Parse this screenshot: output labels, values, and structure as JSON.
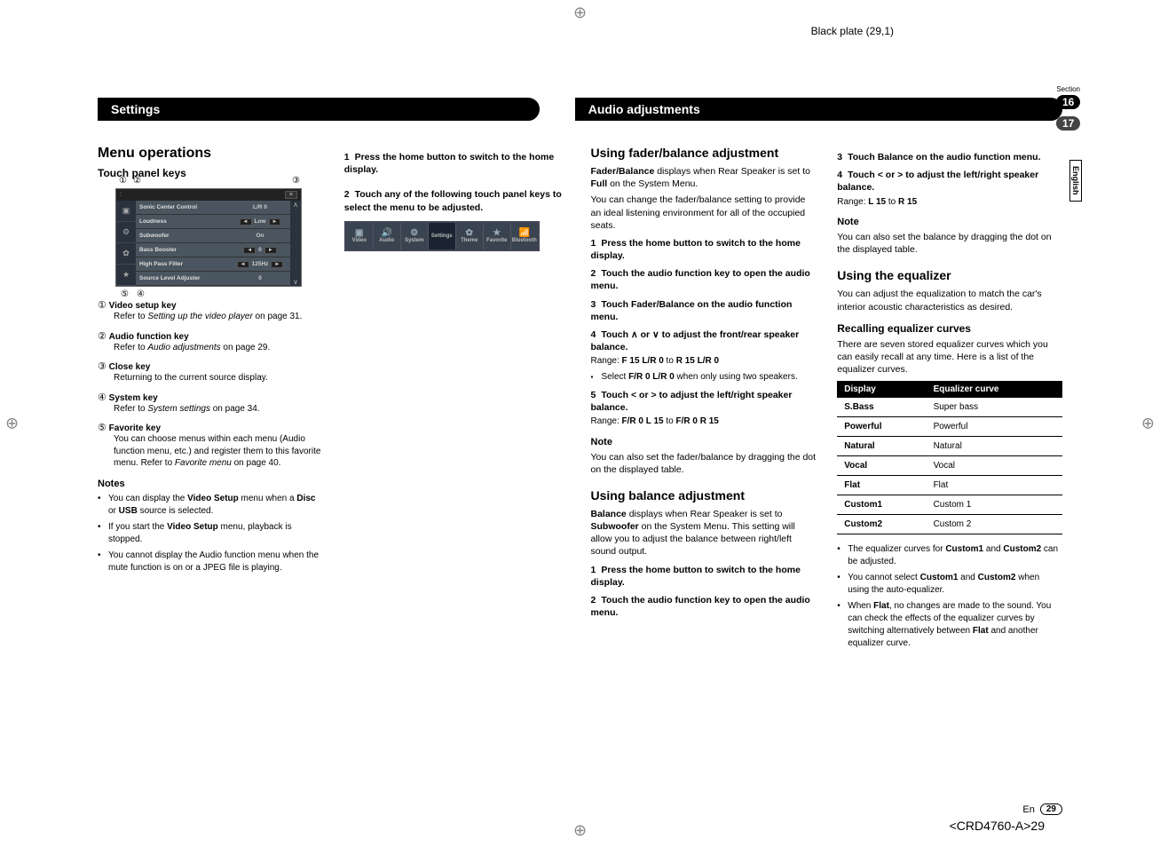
{
  "plate_label": "Black plate (29,1)",
  "header_left": "Settings",
  "header_right": "Audio adjustments",
  "section_label": "Section",
  "section_num_a": "16",
  "section_num_b": "17",
  "lang_tab": "English",
  "col1": {
    "h2": "Menu operations",
    "h3": "Touch panel keys",
    "ui": {
      "title_left": ":",
      "close": "×",
      "rows": [
        {
          "label": "Sonic Center Control",
          "value": "L/R  0",
          "arrows": false
        },
        {
          "label": "Loudness",
          "value": "Low",
          "arrows": true
        },
        {
          "label": "Subwoofer",
          "value": "On",
          "arrows": false
        },
        {
          "label": "Bass Booster",
          "value": "0",
          "arrows": true
        },
        {
          "label": "High Pass Filter",
          "value": "125Hz",
          "arrows": true
        },
        {
          "label": "Source Level Adjuster",
          "value": "0",
          "arrows": false
        }
      ],
      "side_icons": [
        "▣",
        "⚙",
        "✿",
        "★"
      ],
      "callouts": {
        "c1": "①",
        "c2": "②",
        "c3": "③",
        "c4": "④",
        "c5": "⑤"
      }
    },
    "keys": [
      {
        "num": "①",
        "title": "Video setup key",
        "desc_pre": "Refer to ",
        "desc_it": "Setting up the video player",
        "desc_post": " on page 31."
      },
      {
        "num": "②",
        "title": "Audio function key",
        "desc_pre": "Refer to ",
        "desc_it": "Audio adjustments",
        "desc_post": " on page 29."
      },
      {
        "num": "③",
        "title": "Close key",
        "desc_pre": "Returning to the current source display.",
        "desc_it": "",
        "desc_post": ""
      },
      {
        "num": "④",
        "title": "System key",
        "desc_pre": "Refer to ",
        "desc_it": "System settings",
        "desc_post": " on page 34."
      },
      {
        "num": "⑤",
        "title": "Favorite key",
        "desc_pre": "You can choose menus within each menu (Audio function menu, etc.) and register them to this favorite menu.\nRefer to ",
        "desc_it": "Favorite menu",
        "desc_post": " on page 40."
      }
    ],
    "notes_h": "Notes",
    "notes": [
      {
        "pre": "You can display the ",
        "b": "Video Setup",
        "post": " menu when a ",
        "b2": "Disc",
        "mid": " or ",
        "b3": "USB",
        "post2": " source is selected."
      },
      {
        "pre": "If you start the ",
        "b": "Video Setup",
        "post": " menu, playback is stopped."
      },
      {
        "pre": "You cannot display the Audio function menu when the mute function is on or a JPEG file is playing."
      }
    ]
  },
  "col2": {
    "step1_num": "1",
    "step1": "Press the home button to switch to the home display.",
    "step2_num": "2",
    "step2": "Touch any of the following touch panel keys to select the menu to be adjusted.",
    "strip": [
      {
        "icon": "▣",
        "label": "Video"
      },
      {
        "icon": "🔊",
        "label": "Audio"
      },
      {
        "icon": "⚙",
        "label": "System"
      },
      {
        "icon": "",
        "label": "Settings",
        "sel": true
      },
      {
        "icon": "✿",
        "label": "Theme"
      },
      {
        "icon": "★",
        "label": "Favorite"
      },
      {
        "icon": "📶",
        "label": "Bluetooth"
      }
    ]
  },
  "col3": {
    "h2a": "Using fader/balance adjustment",
    "intro_a": "Fader/Balance",
    "intro_b": " displays when Rear Speaker is set to ",
    "intro_c": "Full",
    "intro_d": " on the System Menu.",
    "intro_e": "You can change the fader/balance setting to provide an ideal listening environment for all of the occupied seats.",
    "steps_a": [
      {
        "n": "1",
        "t": "Press the home button to switch to the home display."
      },
      {
        "n": "2",
        "t": "Touch the audio function key to open the audio menu."
      },
      {
        "n": "3",
        "t": "Touch Fader/Balance on the audio function menu."
      },
      {
        "n": "4",
        "t": "Touch ∧ or ∨ to adjust the front/rear speaker balance."
      }
    ],
    "range_a_pre": "Range: ",
    "range_a_b1": "F 15 L/R 0",
    "range_a_mid": " to ",
    "range_a_b2": "R 15 L/R 0",
    "sub_a_pre": "Select ",
    "sub_a_b": "F/R 0  L/R 0",
    "sub_a_post": " when only using two speakers.",
    "step5_n": "5",
    "step5": "Touch < or > to adjust the left/right speaker balance.",
    "range_b_pre": "Range: ",
    "range_b_b1": "F/R 0 L 15",
    "range_b_mid": " to ",
    "range_b_b2": "F/R 0 R 15",
    "note_h": "Note",
    "note_a": "You can also set the fader/balance by dragging the dot on the displayed table.",
    "h2b": "Using balance adjustment",
    "bal_a": "Balance",
    "bal_b": " displays when Rear Speaker is set to ",
    "bal_c": "Subwoofer",
    "bal_d": " on the System Menu. This setting will allow you to adjust the balance between right/left sound output.",
    "steps_b": [
      {
        "n": "1",
        "t": "Press the home button to switch to the home display."
      },
      {
        "n": "2",
        "t": "Touch the audio function key to open the audio menu."
      }
    ]
  },
  "col4": {
    "steps_c": [
      {
        "n": "3",
        "t": "Touch Balance on the audio function menu."
      },
      {
        "n": "4",
        "t": "Touch < or > to adjust the left/right speaker balance."
      }
    ],
    "range_c_pre": "Range: ",
    "range_c_b1": "L 15",
    "range_c_mid": " to ",
    "range_c_b2": "R 15",
    "note_h": "Note",
    "note_b": "You can also set the balance by dragging the dot on the displayed table.",
    "h2c": "Using the equalizer",
    "eq_intro": "You can adjust the equalization to match the car's interior acoustic characteristics as desired.",
    "h3c": "Recalling equalizer curves",
    "eq_desc": "There are seven stored equalizer curves which you can easily recall at any time. Here is a list of the equalizer curves.",
    "table_h1": "Display",
    "table_h2": "Equalizer curve",
    "table": [
      {
        "d": "S.Bass",
        "c": "Super bass"
      },
      {
        "d": "Powerful",
        "c": "Powerful"
      },
      {
        "d": "Natural",
        "c": "Natural"
      },
      {
        "d": "Vocal",
        "c": "Vocal"
      },
      {
        "d": "Flat",
        "c": "Flat"
      },
      {
        "d": "Custom1",
        "c": "Custom 1"
      },
      {
        "d": "Custom2",
        "c": "Custom 2"
      }
    ],
    "bul1_a": "The equalizer curves for ",
    "bul1_b": "Custom1",
    "bul1_c": " and ",
    "bul1_d": "Custom2",
    "bul1_e": " can be adjusted.",
    "bul2_a": "You cannot select ",
    "bul2_b": "Custom1",
    "bul2_c": " and ",
    "bul2_d": "Custom2",
    "bul2_e": " when using the auto-equalizer.",
    "bul3_a": "When ",
    "bul3_b": "Flat",
    "bul3_c": ", no changes are made to the sound. You can check the effects of the equalizer curves by switching alternatively between ",
    "bul3_d": "Flat",
    "bul3_e": " and another equalizer curve."
  },
  "footer_lang": "En",
  "footer_page": "29",
  "doccode": "<CRD4760-A>29"
}
